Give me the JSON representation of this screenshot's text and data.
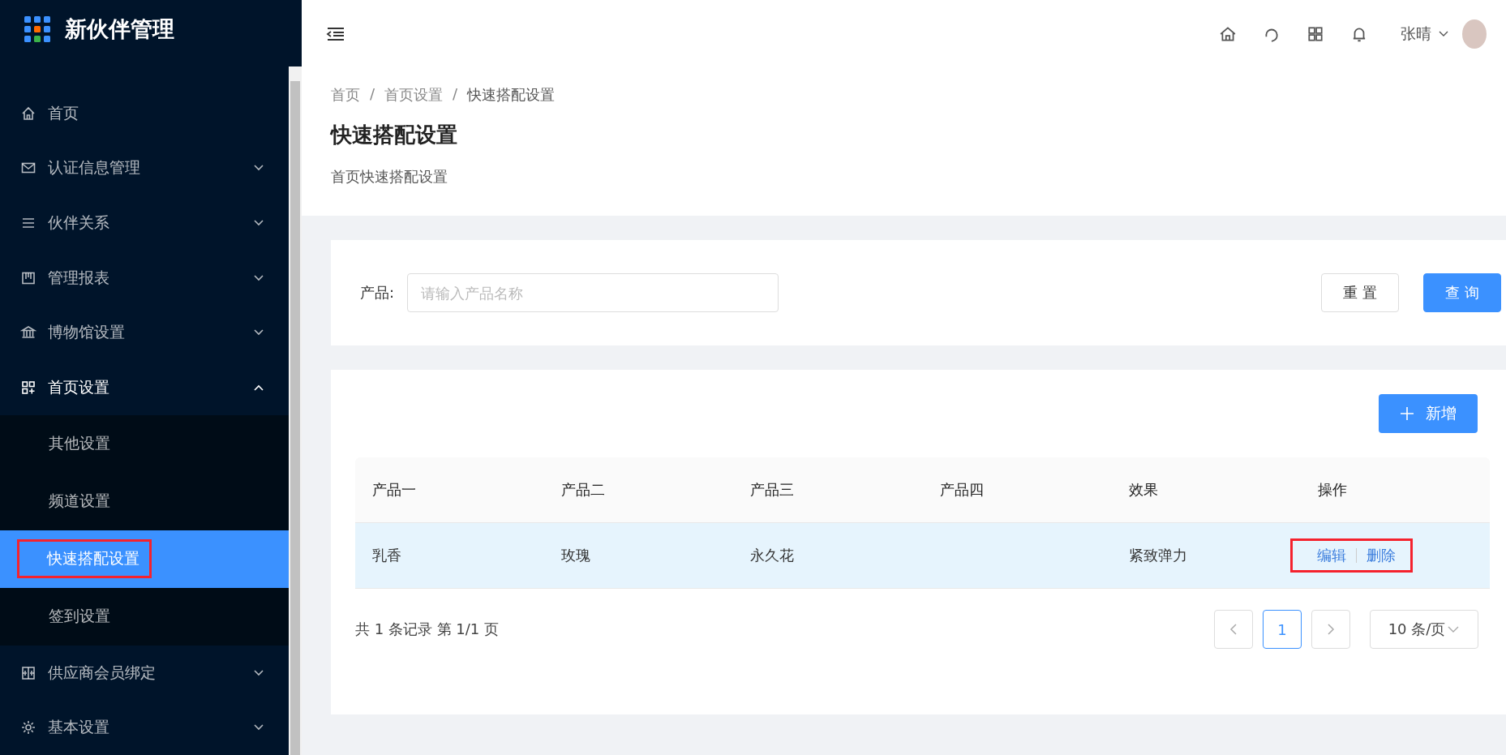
{
  "app": {
    "title": "新伙伴管理"
  },
  "sidebar": {
    "items": [
      {
        "label": "首页",
        "kind": "link",
        "expanded": false
      },
      {
        "label": "认证信息管理",
        "kind": "group",
        "expanded": false
      },
      {
        "label": "伙伴关系",
        "kind": "group",
        "expanded": false
      },
      {
        "label": "管理报表",
        "kind": "group",
        "expanded": false
      },
      {
        "label": "博物馆设置",
        "kind": "group",
        "expanded": false
      },
      {
        "label": "首页设置",
        "kind": "group",
        "expanded": true,
        "children": [
          {
            "label": "其他设置",
            "selected": false,
            "annotated": false
          },
          {
            "label": "频道设置",
            "selected": false,
            "annotated": false
          },
          {
            "label": "快速搭配设置",
            "selected": true,
            "annotated": true
          },
          {
            "label": "签到设置",
            "selected": false,
            "annotated": false
          }
        ]
      },
      {
        "label": "供应商会员绑定",
        "kind": "group",
        "expanded": false
      },
      {
        "label": "基本设置",
        "kind": "group",
        "expanded": false
      }
    ]
  },
  "topbar": {
    "user": "张晴"
  },
  "breadcrumb": [
    {
      "label": "首页",
      "current": false
    },
    {
      "separator": "/",
      "label": "首页设置",
      "current": false
    },
    {
      "separator": "/",
      "label": "快速搭配设置",
      "current": true
    }
  ],
  "page": {
    "title": "快速搭配设置",
    "description": "首页快速搭配设置"
  },
  "filter": {
    "label": "产品:",
    "placeholder": "请输入产品名称",
    "buttons": [
      {
        "label": "重 置",
        "kind": "default"
      },
      {
        "label": "查 询",
        "kind": "primary"
      }
    ]
  },
  "table": {
    "add_button": "新增",
    "columns": [
      "产品一",
      "产品二",
      "产品三",
      "产品四",
      "效果",
      "操作"
    ],
    "rows": [
      {
        "highlighted": true,
        "cells": [
          "乳香",
          "玫瑰",
          "永久花",
          null,
          "紧致弹力"
        ],
        "actions": [
          "编辑",
          "删除"
        ],
        "actions_annotated": true
      }
    ]
  },
  "pagination": {
    "summary": "共 1 条记录 第 1/1 页",
    "pages": [
      {
        "label": "1",
        "selected": true
      }
    ],
    "page_size": "10 条/页"
  }
}
